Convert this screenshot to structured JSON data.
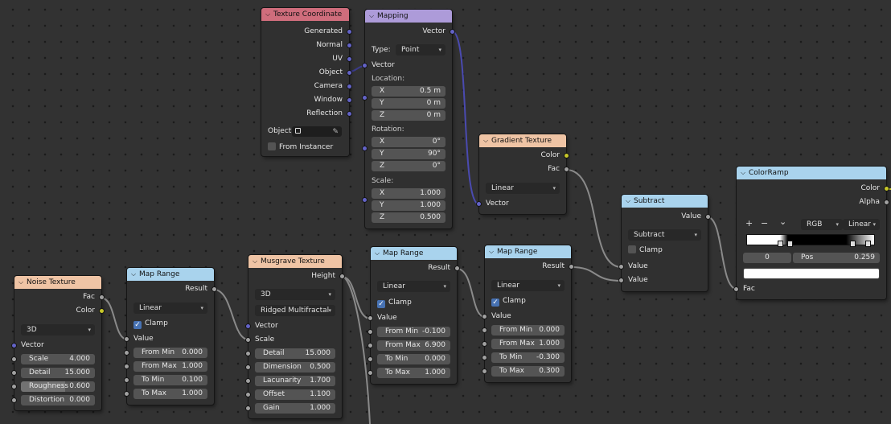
{
  "texture_coordinate": {
    "title": "Texture Coordinate",
    "outputs": [
      "Generated",
      "Normal",
      "UV",
      "Object",
      "Camera",
      "Window",
      "Reflection"
    ],
    "object_label": "Object:",
    "from_instancer": "From Instancer"
  },
  "mapping": {
    "title": "Mapping",
    "output": "Vector",
    "type_label": "Type:",
    "type_value": "Point",
    "vector_label": "Vector",
    "location_label": "Location:",
    "location": [
      {
        "axis": "X",
        "value": "0.5 m"
      },
      {
        "axis": "Y",
        "value": "0 m"
      },
      {
        "axis": "Z",
        "value": "0 m"
      }
    ],
    "rotation_label": "Rotation:",
    "rotation": [
      {
        "axis": "X",
        "value": "0°"
      },
      {
        "axis": "Y",
        "value": "90°"
      },
      {
        "axis": "Z",
        "value": "0°"
      }
    ],
    "scale_label": "Scale:",
    "scale": [
      {
        "axis": "X",
        "value": "1.000"
      },
      {
        "axis": "Y",
        "value": "1.000"
      },
      {
        "axis": "Z",
        "value": "0.500"
      }
    ]
  },
  "gradient_texture": {
    "title": "Gradient Texture",
    "outputs": [
      "Color",
      "Fac"
    ],
    "type_value": "Linear",
    "input": "Vector"
  },
  "subtract": {
    "title": "Subtract",
    "output": "Value",
    "operation": "Subtract",
    "clamp": "Clamp",
    "inputs": [
      "Value",
      "Value"
    ]
  },
  "color_ramp": {
    "title": "ColorRamp",
    "outputs": [
      "Color",
      "Alpha"
    ],
    "add": "+",
    "remove": "−",
    "menu": "⌄",
    "color_mode": "RGB",
    "interpolation": "Linear",
    "index": "0",
    "pos_label": "Pos",
    "pos_value": "0.259",
    "input": "Fac"
  },
  "noise_texture": {
    "title": "Noise Texture",
    "outputs": [
      "Fac",
      "Color"
    ],
    "dimension": "3D",
    "vector": "Vector",
    "fields": [
      {
        "label": "Scale",
        "value": "4.000"
      },
      {
        "label": "Detail",
        "value": "15.000"
      },
      {
        "label": "Roughness",
        "value": "0.600"
      },
      {
        "label": "Distortion",
        "value": "0.000"
      }
    ],
    "roughness_fraction": 0.6
  },
  "map_range_1": {
    "title": "Map Range",
    "output": "Result",
    "interp": "Linear",
    "clamp": "Clamp",
    "value_label": "Value",
    "fields": [
      {
        "label": "From Min",
        "value": "0.000"
      },
      {
        "label": "From Max",
        "value": "1.000"
      },
      {
        "label": "To Min",
        "value": "0.100"
      },
      {
        "label": "To Max",
        "value": "1.000"
      }
    ]
  },
  "musgrave_texture": {
    "title": "Musgrave Texture",
    "output": "Height",
    "dimension": "3D",
    "musgrave_type": "Ridged Multifractal",
    "vector": "Vector",
    "scale": "Scale",
    "fields": [
      {
        "label": "Detail",
        "value": "15.000"
      },
      {
        "label": "Dimension",
        "value": "0.500"
      },
      {
        "label": "Lacunarity",
        "value": "1.700"
      },
      {
        "label": "Offset",
        "value": "1.100"
      },
      {
        "label": "Gain",
        "value": "1.000"
      }
    ]
  },
  "map_range_2": {
    "title": "Map Range",
    "output": "Result",
    "interp": "Linear",
    "clamp": "Clamp",
    "value_label": "Value",
    "fields": [
      {
        "label": "From Min",
        "value": "-0.100"
      },
      {
        "label": "From Max",
        "value": "6.900"
      },
      {
        "label": "To Min",
        "value": "0.000"
      },
      {
        "label": "To Max",
        "value": "1.000"
      }
    ]
  },
  "map_range_3": {
    "title": "Map Range",
    "output": "Result",
    "interp": "Linear",
    "clamp": "Clamp",
    "value_label": "Value",
    "fields": [
      {
        "label": "From Min",
        "value": "0.000"
      },
      {
        "label": "From Max",
        "value": "1.000"
      },
      {
        "label": "To Min",
        "value": "-0.300"
      },
      {
        "label": "To Max",
        "value": "0.300"
      }
    ]
  },
  "colors": {
    "input_header": "#cf6d7c",
    "vector_header": "#ad9bd9",
    "texture_header": "#efc4a5",
    "converter_header": "#a9d3ed",
    "vector_socket": "#6363c7",
    "color_socket": "#c7c729",
    "value_socket": "#a1a1a1",
    "accent": "#4772b3"
  }
}
